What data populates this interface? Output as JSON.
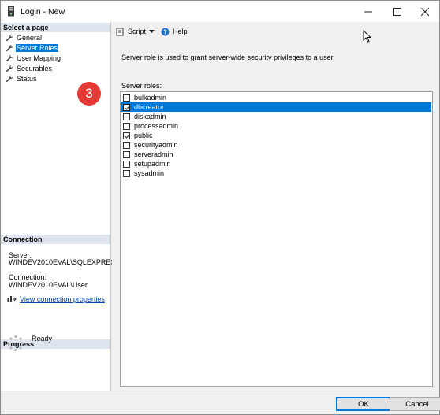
{
  "window": {
    "title": "Login - New"
  },
  "left": {
    "select_header": "Select a page",
    "pages": [
      {
        "label": "General",
        "selected": false
      },
      {
        "label": "Server Roles",
        "selected": true
      },
      {
        "label": "User Mapping",
        "selected": false
      },
      {
        "label": "Securables",
        "selected": false
      },
      {
        "label": "Status",
        "selected": false
      }
    ],
    "step_badge": "3",
    "connection_header": "Connection",
    "server_label": "Server:",
    "server_value": "WINDEV2010EVAL\\SQLEXPRES",
    "connection_label": "Connection:",
    "connection_value": "WINDEV2010EVAL\\User",
    "view_connection_link": "View connection properties",
    "progress_header": "Progress",
    "progress_status": "Ready"
  },
  "toolbar": {
    "script_label": "Script",
    "help_label": "Help"
  },
  "main": {
    "description": "Server role is used to grant server-wide security privileges to a user.",
    "roles_label": "Server roles:",
    "roles": [
      {
        "name": "bulkadmin",
        "checked": false,
        "selected": false
      },
      {
        "name": "dbcreator",
        "checked": true,
        "selected": true
      },
      {
        "name": "diskadmin",
        "checked": false,
        "selected": false
      },
      {
        "name": "processadmin",
        "checked": false,
        "selected": false
      },
      {
        "name": "public",
        "checked": true,
        "selected": false
      },
      {
        "name": "securityadmin",
        "checked": false,
        "selected": false
      },
      {
        "name": "serveradmin",
        "checked": false,
        "selected": false
      },
      {
        "name": "setupadmin",
        "checked": false,
        "selected": false
      },
      {
        "name": "sysadmin",
        "checked": false,
        "selected": false
      }
    ]
  },
  "footer": {
    "ok_label": "OK",
    "cancel_label": "Cancel"
  },
  "colors": {
    "selection": "#0078d7",
    "section_header": "#dde4ee",
    "badge": "#e53935",
    "link": "#0645ad"
  }
}
